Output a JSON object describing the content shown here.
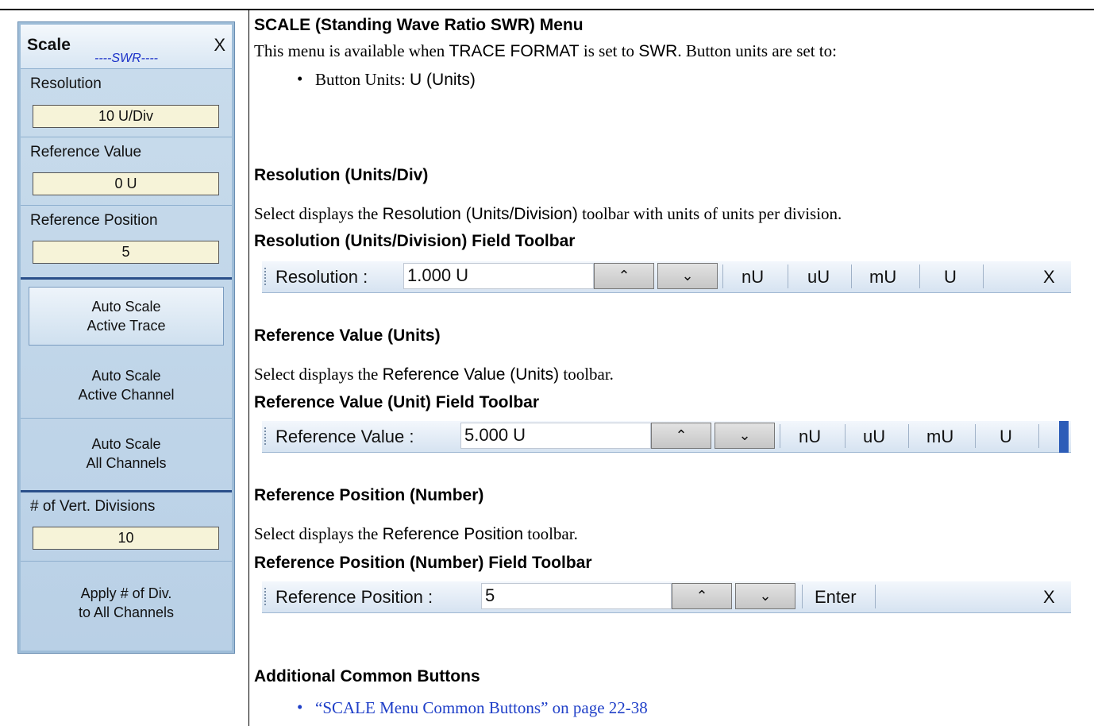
{
  "panel": {
    "title": "Scale",
    "close": "X",
    "subtitle": "----SWR----",
    "resolution_label": "Resolution",
    "resolution_value": "10 U/Div",
    "ref_value_label": "Reference Value",
    "ref_value_value": "0 U",
    "ref_position_label": "Reference Position",
    "ref_position_value": "5",
    "auto_scale_trace": [
      "Auto Scale",
      "Active Trace"
    ],
    "auto_scale_channel": [
      "Auto Scale",
      "Active Channel"
    ],
    "auto_scale_all": [
      "Auto Scale",
      "All Channels"
    ],
    "vert_div_label": "# of Vert. Divisions",
    "vert_div_value": "10",
    "apply_div": [
      "Apply # of Div.",
      "to All Channels"
    ]
  },
  "doc": {
    "heading": "SCALE (Standing Wave Ratio SWR) Menu",
    "intro_1": "This menu is available when ",
    "intro_2": "TRACE FORMAT",
    "intro_3": " is set to ",
    "intro_4": "SWR",
    "intro_5": ". Button units are set to:",
    "bullet_1a": "Button Units: ",
    "bullet_1b": "U (Units)",
    "res_heading": "Resolution (Units/Div)",
    "res_desc_1": "Select displays the ",
    "res_desc_2": "Resolution (Units/Division)",
    "res_desc_3": " toolbar with units of units per division.",
    "res_tb_heading": "Resolution (Units/Division) Field Toolbar",
    "refval_heading": "Reference Value (Units)",
    "refval_desc_1": "Select displays the ",
    "refval_desc_2": "Reference Value (Units)",
    "refval_desc_3": " toolbar.",
    "refval_tb_heading": "Reference Value (Unit) Field Toolbar",
    "refpos_heading": "Reference Position (Number)",
    "refpos_desc_1": "Select displays the ",
    "refpos_desc_2": "Reference Position",
    "refpos_desc_3": " toolbar.",
    "refpos_tb_heading": "Reference Position (Number) Field Toolbar",
    "common_heading": "Additional Common Buttons",
    "common_link": "“SCALE Menu Common Buttons” on page 22-38"
  },
  "toolbars": {
    "resolution": {
      "label": "Resolution  :",
      "value": "1.000  U",
      "units": [
        "nU",
        "uU",
        "mU",
        "U"
      ],
      "close": "X"
    },
    "ref_value": {
      "label": "Reference Value  :",
      "value": "5.000  U",
      "units": [
        "nU",
        "uU",
        "mU",
        "U"
      ]
    },
    "ref_position": {
      "label": "Reference Position  :",
      "value": "5",
      "enter": "Enter",
      "close": "X"
    }
  },
  "icons": {
    "up": "chevron-up-icon",
    "down": "chevron-down-icon"
  },
  "colors": {
    "panel_bg": "#b9d0e6",
    "field_bg": "#f6f3d8",
    "subtitle": "#1a30c8",
    "link": "#2040c8"
  }
}
